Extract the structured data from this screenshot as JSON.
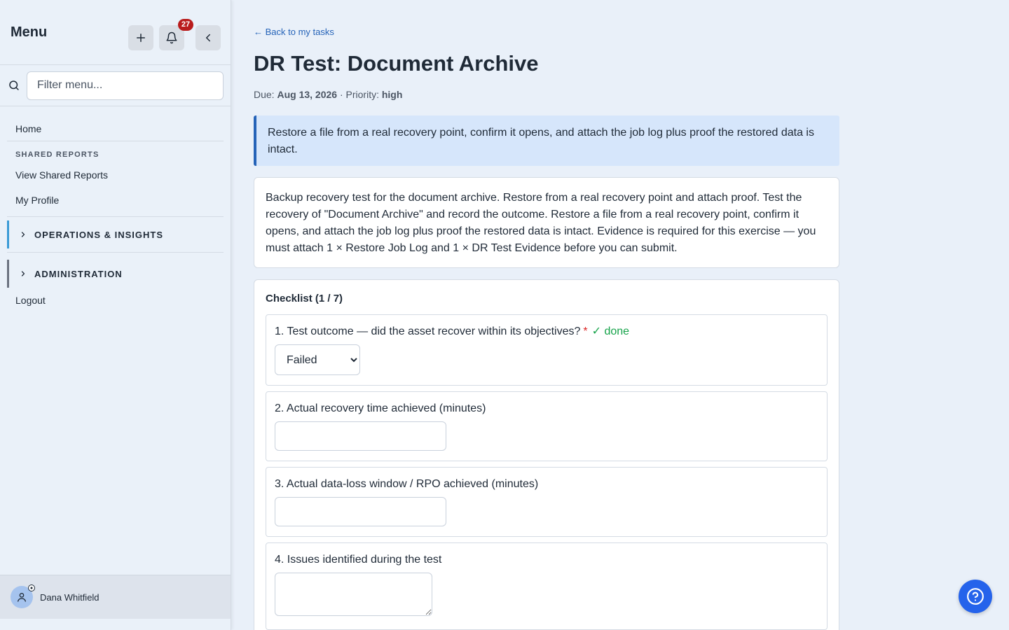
{
  "sidebar": {
    "title": "Menu",
    "notification_count": "27",
    "search_placeholder": "Filter menu...",
    "home": "Home",
    "section_shared_reports": "SHARED REPORTS",
    "view_shared_reports": "View Shared Reports",
    "my_profile": "My Profile",
    "group_operations": "OPERATIONS & INSIGHTS",
    "group_administration": "ADMINISTRATION",
    "logout": "Logout",
    "user_name": "Dana Whitfield"
  },
  "main": {
    "back_link": "← Back to my tasks",
    "title": "DR Test: Document Archive",
    "due_label": "Due:",
    "due_value": "Aug 13, 2026",
    "priority_label": "· Priority:",
    "priority_value": "high",
    "callout": "Restore a file from a real recovery point, confirm it opens, and attach the job log plus proof the restored data is intact.",
    "description": "Backup recovery test for the document archive. Restore from a real recovery point and attach proof. Test the recovery of \"Document Archive\" and record the outcome. Restore a file from a real recovery point, confirm it opens, and attach the job log plus proof the restored data is intact. Evidence is required for this exercise — you must attach 1 × Restore Job Log and 1 × DR Test Evidence before you can submit.",
    "checklist_title": "Checklist (1 / 7)",
    "items": [
      {
        "label": "1. Test outcome — did the asset recover within its objectives?",
        "required": "*",
        "status": "✓ done",
        "value": "Failed"
      },
      {
        "label": "2. Actual recovery time achieved (minutes)"
      },
      {
        "label": "3. Actual data-loss window / RPO achieved (minutes)"
      },
      {
        "label": "4. Issues identified during the test"
      }
    ]
  },
  "colors": {
    "accent": "#2563b8",
    "ops_border": "#3b9bd6",
    "badge": "#b91c1c",
    "done": "#16a34a",
    "required": "#dc2626"
  }
}
